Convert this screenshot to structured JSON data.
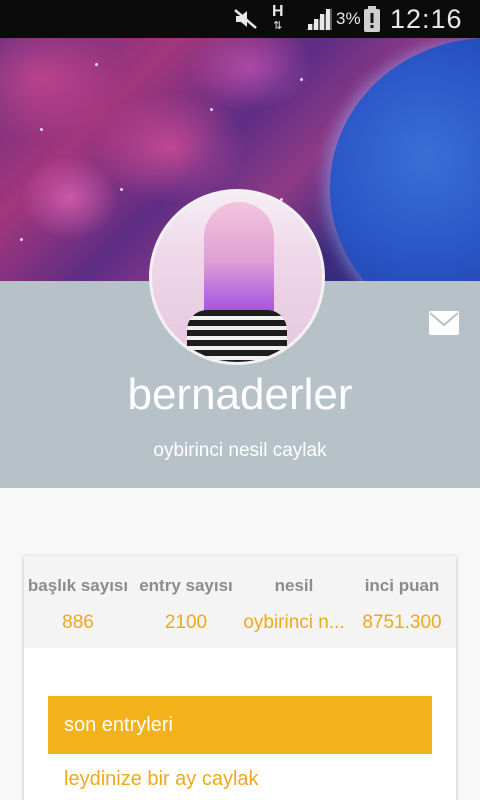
{
  "status_bar": {
    "network_type": "H",
    "network_arrows": "⇅",
    "battery_percent": "3%",
    "time": "12:16"
  },
  "profile": {
    "username": "bernaderler",
    "generation_title": "oybirinci nesil caylak"
  },
  "stats": [
    {
      "label": "başlık sayısı",
      "value": "886"
    },
    {
      "label": "entry sayısı",
      "value": "2100"
    },
    {
      "label": "nesil",
      "value": "oybirinci n..."
    },
    {
      "label": "inci puan",
      "value": "8751.300"
    }
  ],
  "entries_section": {
    "title": "son entryleri",
    "items": [
      "leydinize bir ay caylak"
    ]
  },
  "colors": {
    "accent": "#f3b11a",
    "profile_band": "#b6c2c8",
    "status_bar": "#0b0b0b"
  }
}
